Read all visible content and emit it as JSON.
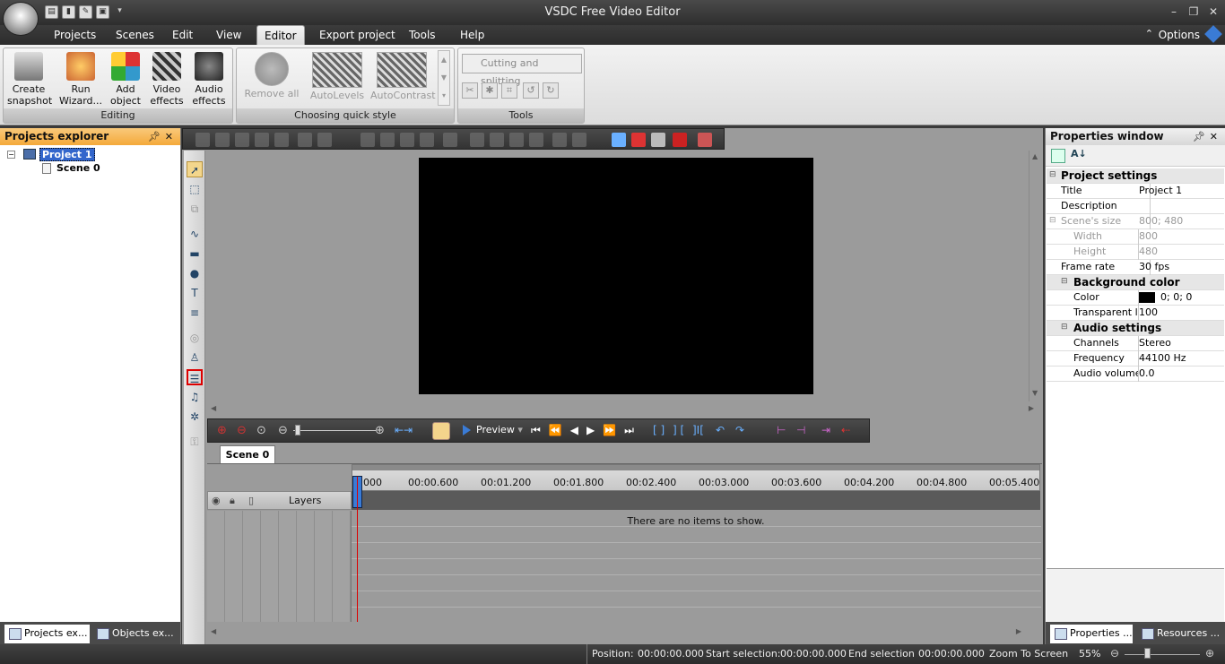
{
  "app": {
    "title": "VSDC Free Video Editor"
  },
  "menu": {
    "tabs": [
      "Projects",
      "Scenes",
      "Edit",
      "View",
      "Editor",
      "Export project",
      "Tools",
      "Help"
    ],
    "active": "Editor",
    "options": "Options"
  },
  "ribbon": {
    "editing": {
      "label": "Editing",
      "create_snapshot": "Create\nsnapshot",
      "run_wizard": "Run\nWizard...",
      "add_object": "Add\nobject",
      "video_effects": "Video\neffects",
      "audio_effects": "Audio\neffects"
    },
    "quickstyle": {
      "label": "Choosing quick style",
      "remove_all": "Remove all",
      "autolevels": "AutoLevels",
      "autocontrast": "AutoContrast"
    },
    "tools": {
      "label": "Tools",
      "cutting": "Cutting and splitting"
    }
  },
  "projects_explorer": {
    "title": "Projects explorer",
    "project": "Project 1",
    "scene": "Scene 0",
    "tab_projects": "Projects ex...",
    "tab_objects": "Objects ex..."
  },
  "preview_toolbar": {
    "preview": "Preview"
  },
  "timeline": {
    "scene_tab": "Scene 0",
    "layers": "Layers",
    "empty": "There are no items to show.",
    "ruler": [
      "000",
      "00:00.600",
      "00:01.200",
      "00:01.800",
      "00:02.400",
      "00:03.000",
      "00:03.600",
      "00:04.200",
      "00:04.800",
      "00:05.400"
    ]
  },
  "properties": {
    "title": "Properties window",
    "project_settings": "Project settings",
    "title_key": "Title",
    "title_val": "Project 1",
    "desc_key": "Description",
    "desc_val": "",
    "size_key": "Scene's size",
    "size_val": "800; 480",
    "width_key": "Width",
    "width_val": "800",
    "height_key": "Height",
    "height_val": "480",
    "fps_key": "Frame rate",
    "fps_val": "30 fps",
    "bg_cat": "Background color",
    "color_key": "Color",
    "color_val": "0; 0; 0",
    "transp_key": "Transparent le",
    "transp_val": "100",
    "audio_cat": "Audio settings",
    "channels_key": "Channels",
    "channels_val": "Stereo",
    "freq_key": "Frequency",
    "freq_val": "44100 Hz",
    "vol_key": "Audio volume (",
    "vol_val": "0.0",
    "tab_props": "Properties ...",
    "tab_res": "Resources ..."
  },
  "status": {
    "position_label": "Position:",
    "position_val": "00:00:00.000",
    "start_label": "Start selection:",
    "start_val": "00:00:00.000",
    "end_label": "End selection",
    "end_val": "00:00:00.000",
    "zoom_label": "Zoom To Screen",
    "zoom_val": "55%"
  }
}
